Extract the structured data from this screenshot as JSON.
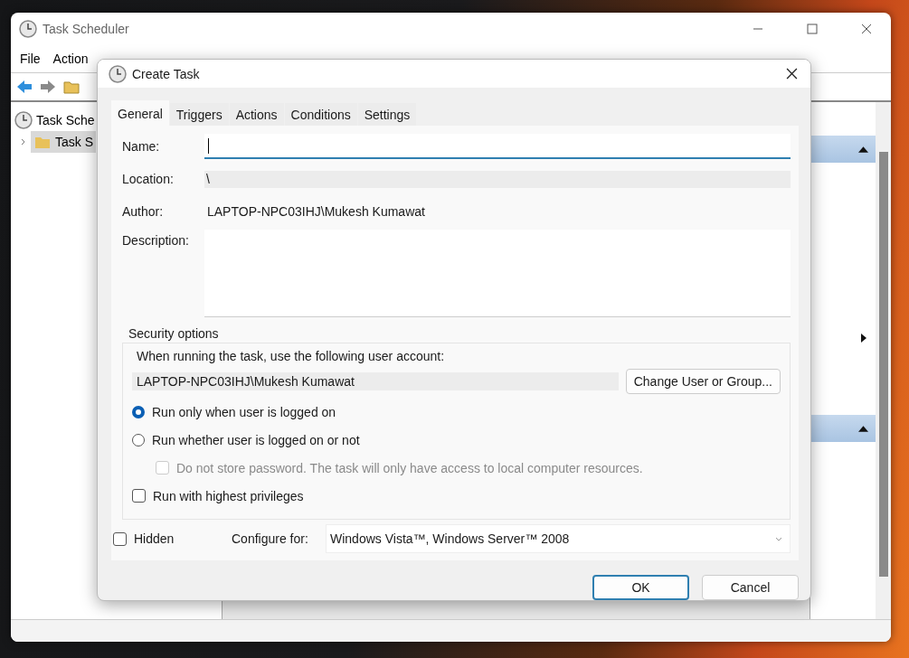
{
  "main_window": {
    "title": "Task Scheduler",
    "menu": [
      "File",
      "Action"
    ],
    "tree": [
      {
        "label": "Task Sche",
        "children": [
          {
            "label": "Task S",
            "selected": true,
            "expanded": false
          }
        ]
      }
    ]
  },
  "dialog": {
    "title": "Create Task",
    "tabs": [
      {
        "label": "General",
        "selected": true
      },
      {
        "label": "Triggers",
        "selected": false
      },
      {
        "label": "Actions",
        "selected": false
      },
      {
        "label": "Conditions",
        "selected": false
      },
      {
        "label": "Settings",
        "selected": false
      }
    ],
    "name": {
      "label": "Name:",
      "focused": true
    },
    "location": {
      "label": "Location:",
      "value": "\\"
    },
    "author": {
      "label": "Author:",
      "value": "LAPTOP-NPC03IHJ\\Mukesh Kumawat"
    },
    "description": {
      "label": "Description:"
    },
    "security": {
      "legend": "Security options",
      "prompt": "When running the task, use the following user account:",
      "account": "LAPTOP-NPC03IHJ\\Mukesh Kumawat",
      "change_button": "Change User or Group...",
      "options": [
        {
          "kind": "radio",
          "label": "Run only when user is logged on",
          "selected": true,
          "disabled": false
        },
        {
          "kind": "radio",
          "label": "Run whether user is logged on or not",
          "selected": false,
          "disabled": false,
          "children": [
            {
              "kind": "checkbox",
              "label": "Do not store password.  The task will only have access to local computer resources.",
              "checked": false,
              "disabled": true
            }
          ]
        },
        {
          "kind": "checkbox",
          "label": "Run with highest privileges",
          "checked": false,
          "disabled": false
        }
      ]
    },
    "hidden": {
      "label": "Hidden",
      "checked": false
    },
    "configure": {
      "label": "Configure for:",
      "value": "Windows Vista™, Windows Server™ 2008"
    },
    "buttons": [
      {
        "label": "OK",
        "default": true
      },
      {
        "label": "Cancel",
        "default": false
      }
    ]
  }
}
